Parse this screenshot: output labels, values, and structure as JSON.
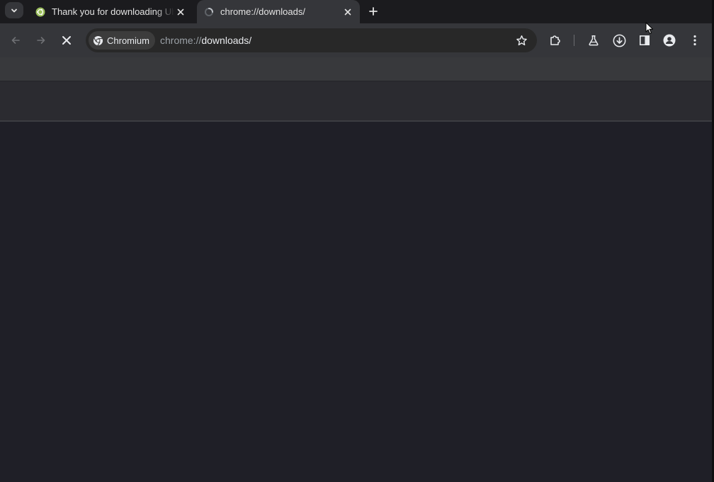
{
  "tabs": [
    {
      "title": "Thank you for downloading Ubuntu Desktop",
      "state": "inactive",
      "favicon": "ubuntu-favicon"
    },
    {
      "title": "chrome://downloads/",
      "state": "active",
      "favicon": "loading-spinner-favicon"
    }
  ],
  "toolbar": {
    "back_icon": "arrow-left-icon",
    "forward_icon": "arrow-right-icon",
    "stop_icon": "close-icon",
    "omnibox": {
      "chip_label": "Chromium",
      "url_scheme": "chrome://",
      "url_rest": "downloads/"
    },
    "actions": [
      "bookmark-star-icon",
      "extensions-icon",
      "labs-flask-icon",
      "downloads-icon",
      "side-panel-icon",
      "profile-icon",
      "menu-icon"
    ]
  },
  "colors": {
    "tabstrip": "#1b1b1e",
    "toolbar": "#35363a",
    "omnibox": "#282828",
    "page_body": "#1f1f27"
  }
}
